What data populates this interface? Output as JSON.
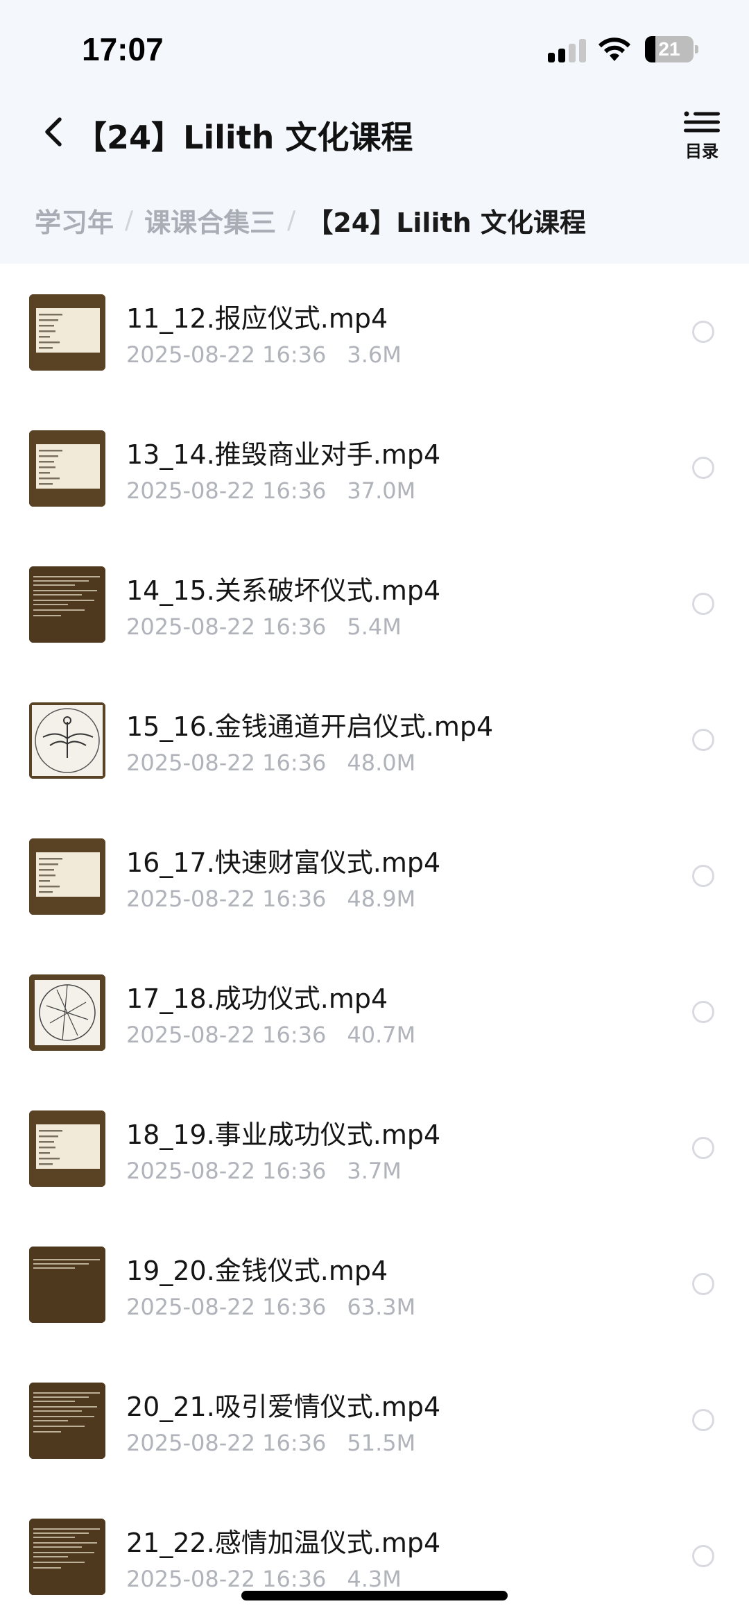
{
  "status_bar": {
    "time": "17:07",
    "battery_level": "21",
    "battery_fraction": 0.21,
    "signal_bars_active": 2,
    "signal_bars_total": 4
  },
  "nav": {
    "back_icon": "chevron-left-icon",
    "title": "【24】Lilith 文化课程",
    "catalog_icon": "list-icon",
    "catalog_label": "目录"
  },
  "breadcrumb": {
    "items": [
      "学习年",
      "课课合集三",
      "【24】Lilith 文化课程"
    ],
    "separator": "/"
  },
  "files": [
    {
      "name": "11_12.报应仪式.mp4",
      "date": "2025-08-22 16:36",
      "size": "3.6M",
      "thumb_style": "paper-note"
    },
    {
      "name": "13_14.推毁商业对手.mp4",
      "date": "2025-08-22 16:36",
      "size": "37.0M",
      "thumb_style": "paper-note"
    },
    {
      "name": "14_15.关系破坏仪式.mp4",
      "date": "2025-08-22 16:36",
      "size": "5.4M",
      "thumb_style": "dark-text"
    },
    {
      "name": "15_16.金钱通道开启仪式.mp4",
      "date": "2025-08-22 16:36",
      "size": "48.0M",
      "thumb_style": "sigil-figure"
    },
    {
      "name": "16_17.快速财富仪式.mp4",
      "date": "2025-08-22 16:36",
      "size": "48.9M",
      "thumb_style": "paper-note"
    },
    {
      "name": "17_18.成功仪式.mp4",
      "date": "2025-08-22 16:36",
      "size": "40.7M",
      "thumb_style": "sigil-circle"
    },
    {
      "name": "18_19.事业成功仪式.mp4",
      "date": "2025-08-22 16:36",
      "size": "3.7M",
      "thumb_style": "paper-note"
    },
    {
      "name": "19_20.金钱仪式.mp4",
      "date": "2025-08-22 16:36",
      "size": "63.3M",
      "thumb_style": "dark-text-sparse"
    },
    {
      "name": "20_21.吸引爱情仪式.mp4",
      "date": "2025-08-22 16:36",
      "size": "51.5M",
      "thumb_style": "dark-text"
    },
    {
      "name": "21_22.感情加温仪式.mp4",
      "date": "2025-08-22 16:36",
      "size": "4.3M",
      "thumb_style": "dark-text"
    }
  ],
  "colors": {
    "thumb_brown": "#5a4224",
    "paper": "#f1ead8",
    "meta_gray": "#b0b3ba",
    "crumb_gray": "#a9adb6"
  }
}
